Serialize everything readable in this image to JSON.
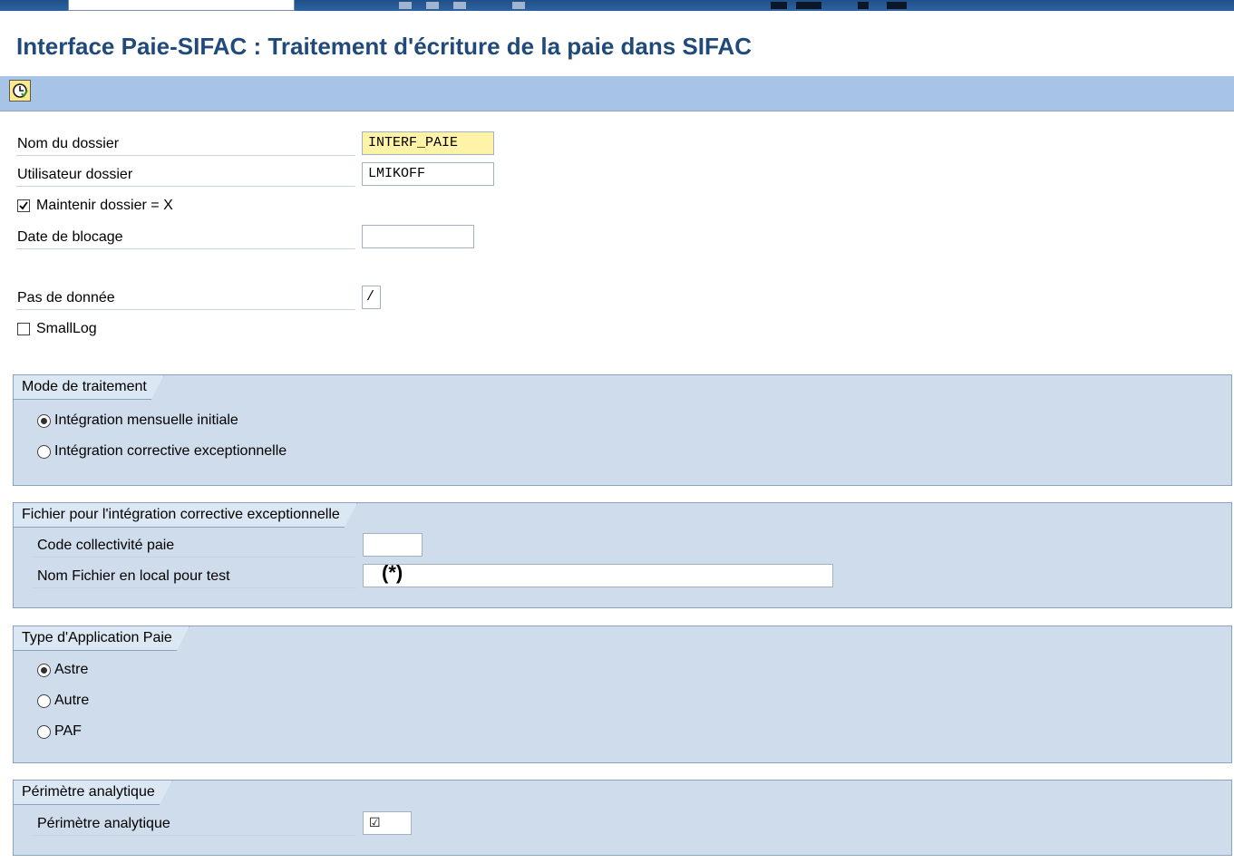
{
  "window": {
    "title": "Interface Paie-SIFAC : Traitement d'écriture de la paie dans SIFAC"
  },
  "toolbar": {
    "execute_icon": "execute-clock-icon"
  },
  "params": {
    "nom_dossier": {
      "label": "Nom du dossier",
      "value": "INTERF_PAIE"
    },
    "utilisateur": {
      "label": "Utilisateur dossier",
      "value": "LMIKOFF"
    },
    "maintenir": {
      "label": "Maintenir dossier = X",
      "checked": true
    },
    "date_blocage": {
      "label": "Date de blocage",
      "value": ""
    },
    "pas_donnee": {
      "label": "Pas de donnée",
      "value": "/"
    },
    "smalllog": {
      "label": "SmallLog",
      "checked": false
    }
  },
  "mode": {
    "title": "Mode de traitement",
    "options": [
      {
        "label": "Intégration mensuelle initiale",
        "selected": true
      },
      {
        "label": "Intégration corrective exceptionnelle",
        "selected": false
      }
    ]
  },
  "fichier": {
    "title": "Fichier pour l'intégration corrective exceptionnelle",
    "code": {
      "label": "Code collectivité paie",
      "value": ""
    },
    "nom": {
      "label": "Nom Fichier en local pour test",
      "value": "",
      "annotation": "(*)"
    }
  },
  "type_app": {
    "title": "Type d'Application Paie",
    "options": [
      {
        "label": "Astre",
        "selected": true
      },
      {
        "label": "Autre",
        "selected": false
      },
      {
        "label": "PAF",
        "selected": false
      }
    ]
  },
  "perimetre": {
    "title": "Périmètre analytique",
    "field": {
      "label": "Périmètre analytique",
      "value": "☑"
    }
  }
}
